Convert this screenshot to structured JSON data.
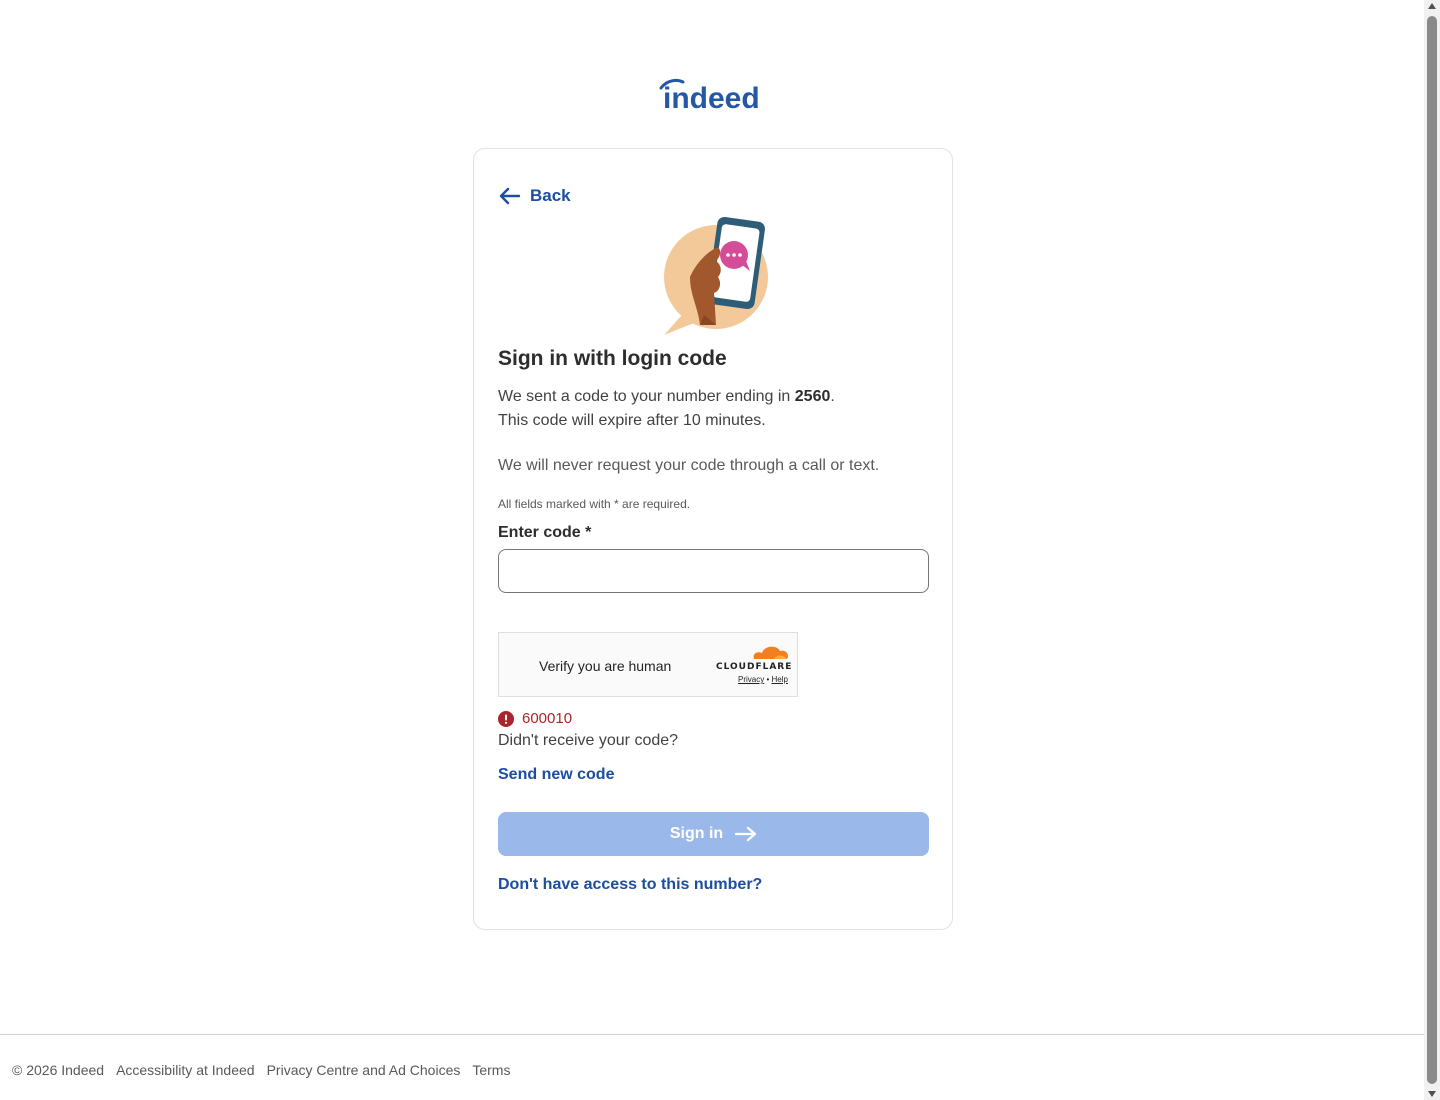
{
  "brand": {
    "logo_text": "indeed",
    "logo_color": "#2557a7"
  },
  "card": {
    "back_label": "Back",
    "title": "Sign in with login code",
    "description_prefix": "We sent a code to your number ending in ",
    "phone_last_digits": "2560",
    "description_suffix": ".",
    "expiry_text": "This code will expire after 10 minutes.",
    "security_notice": "We will never request your code through a call or text.",
    "required_note": "All fields marked with * are required.",
    "code_field": {
      "label": "Enter code *",
      "value": "",
      "placeholder": ""
    },
    "captcha": {
      "text": "Verify you are human",
      "provider": "CLOUDFLARE",
      "privacy_link": "Privacy",
      "separator": "•",
      "help_link": "Help"
    },
    "error": {
      "code": "600010",
      "color": "#a9252b"
    },
    "resend_question": "Didn't receive your code?",
    "resend_link": "Send new code",
    "signin_label": "Sign in",
    "no_access_link": "Don't have access to this number?"
  },
  "footer": {
    "copyright": "© 2026 Indeed",
    "links": [
      "Accessibility at Indeed",
      "Privacy Centre and Ad Choices",
      "Terms"
    ]
  },
  "colors": {
    "accent": "#1c4ea0",
    "button_disabled": "#9ab8ea",
    "border": "#e4e2e0"
  },
  "icons": [
    "indeed-logo",
    "arrow-left-icon",
    "phone-message-illustration",
    "cloudflare-logo",
    "error-icon",
    "arrow-right-icon"
  ]
}
